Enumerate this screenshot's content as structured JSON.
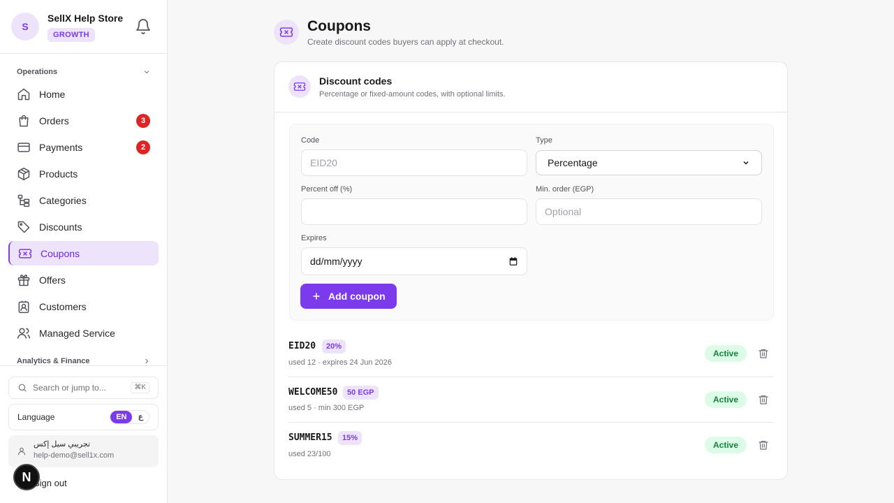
{
  "store": {
    "avatar_letter": "S",
    "name": "SellX Help Store",
    "plan": "GROWTH"
  },
  "sidebar": {
    "sections": {
      "operations": "Operations",
      "analytics": "Analytics & Finance"
    },
    "items": [
      {
        "label": "Home",
        "icon": "home-icon"
      },
      {
        "label": "Orders",
        "icon": "shopping-bag-icon",
        "count": "3"
      },
      {
        "label": "Payments",
        "icon": "credit-card-icon",
        "count": "2"
      },
      {
        "label": "Products",
        "icon": "package-icon"
      },
      {
        "label": "Categories",
        "icon": "folder-tree-icon"
      },
      {
        "label": "Discounts",
        "icon": "tag-icon"
      },
      {
        "label": "Coupons",
        "icon": "ticket-icon",
        "active": true
      },
      {
        "label": "Offers",
        "icon": "gift-icon"
      },
      {
        "label": "Customers",
        "icon": "contact-icon"
      },
      {
        "label": "Managed Service",
        "icon": "users-icon"
      }
    ],
    "search": {
      "placeholder": "Search or jump to...",
      "shortcut": "⌘K"
    },
    "language": {
      "label": "Language",
      "en": "EN",
      "ar": "ع"
    },
    "user": {
      "name": "تجريبي سيل إكس",
      "email": "help-demo@sell1x.com"
    },
    "sign_out": "Sign out",
    "n_badge": "N"
  },
  "page": {
    "title": "Coupons",
    "subtitle": "Create discount codes buyers can apply at checkout."
  },
  "card": {
    "title": "Discount codes",
    "subtitle": "Percentage or fixed-amount codes, with optional limits."
  },
  "form": {
    "code_label": "Code",
    "code_placeholder": "EID20",
    "type_label": "Type",
    "type_value": "Percentage",
    "percent_label": "Percent off (%)",
    "min_label": "Min. order (EGP)",
    "min_placeholder": "Optional",
    "expires_label": "Expires",
    "expires_value": "dd/mm/yyyy",
    "add_button": "Add coupon"
  },
  "coupons": [
    {
      "code": "EID20",
      "value": "20%",
      "meta": "used 12 · expires 24 Jun 2026",
      "status": "Active"
    },
    {
      "code": "WELCOME50",
      "value": "50 EGP",
      "meta": "used 5 · min 300 EGP",
      "status": "Active"
    },
    {
      "code": "SUMMER15",
      "value": "15%",
      "meta": "used 23/100",
      "status": "Active"
    }
  ],
  "colors": {
    "accent": "#7c3aed",
    "accent_soft": "#ede4fb",
    "badge_red": "#dc2626",
    "active_green": "#15803d"
  }
}
